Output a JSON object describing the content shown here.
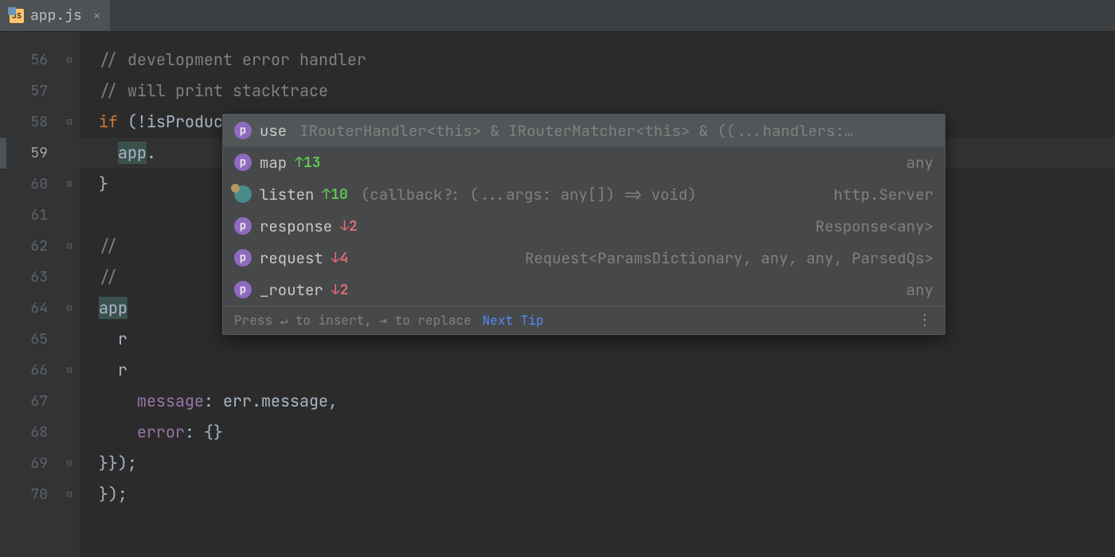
{
  "tab": {
    "filename": "app.js",
    "icon_label": "JS"
  },
  "gutter": {
    "lines": [
      "56",
      "57",
      "58",
      "59",
      "60",
      "61",
      "62",
      "63",
      "64",
      "65",
      "66",
      "67",
      "68",
      "69",
      "70"
    ],
    "active_index": 3
  },
  "code": {
    "l56": "// development error handler",
    "l57": "// will print stacktrace",
    "l58_if": "if",
    "l58_rest": " (!isProduction) {",
    "l59_app": "app",
    "l59_dot": ".",
    "l60": "}",
    "l62": "// ",
    "l63": "// ",
    "l64_app": "app",
    "l65": "r",
    "l66": "r",
    "l67_msg": "message",
    "l67_rest": ": err.message,",
    "l68_err": "error",
    "l68_rest": ": {}",
    "l69": "}});",
    "l70": "});"
  },
  "popup": {
    "items": [
      {
        "badge": "p",
        "name": "use",
        "rank": "",
        "rank_dir": "",
        "hint": "IRouterHandler<this> & IRouterMatcher<this> & ((...handlers:…",
        "type": ""
      },
      {
        "badge": "p",
        "name": "map",
        "rank": "↑13",
        "rank_dir": "up",
        "hint": "",
        "type": "any"
      },
      {
        "badge": "m",
        "name": "listen",
        "rank": "↑10",
        "rank_dir": "up",
        "hint": "(callback?: (...args: any[]) => void)",
        "type": "http.Server"
      },
      {
        "badge": "p",
        "name": "response",
        "rank": "↓2",
        "rank_dir": "down",
        "hint": "",
        "type": "Response<any>"
      },
      {
        "badge": "p",
        "name": "request",
        "rank": "↓4",
        "rank_dir": "down",
        "hint": "",
        "type": "Request<ParamsDictionary, any, any, ParsedQs>"
      },
      {
        "badge": "p",
        "name": "_router",
        "rank": "↓2",
        "rank_dir": "down",
        "hint": "",
        "type": "any"
      }
    ],
    "footer_text": "Press ↵ to insert, ⇥ to replace",
    "footer_link": "Next Tip"
  }
}
